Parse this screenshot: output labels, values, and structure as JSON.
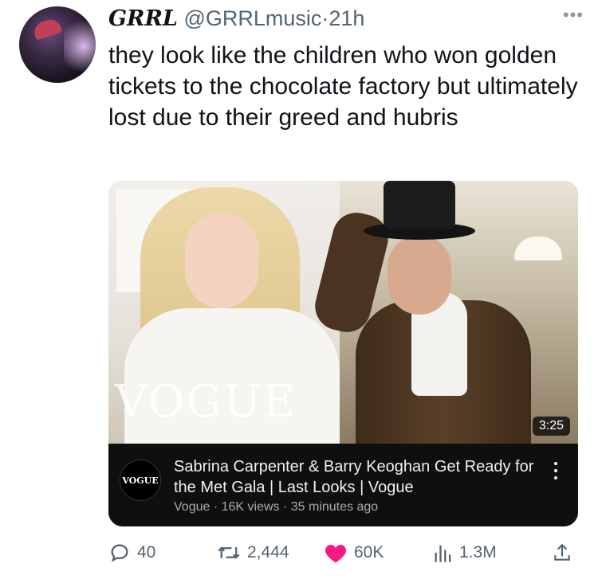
{
  "tweet": {
    "display_name": "GRRL",
    "handle": "@GRRLmusic",
    "separator": "·",
    "time": "21h",
    "more_icon": "more-horizontal-icon",
    "text": "they look like the children who won golden tickets to the chocolate factory but ultimately lost due to their greed and hubris"
  },
  "media": {
    "watermark": "VOGUE",
    "duration": "3:25",
    "channel_avatar_text": "VOGUE",
    "title": "Sabrina Carpenter & Barry Keoghan Get Ready for the Met Gala | Last Looks | Vogue",
    "meta": "Vogue · 16K views · 35 minutes ago"
  },
  "actions": {
    "replies": "40",
    "retweets": "2,444",
    "likes": "60K",
    "views": "1.3M"
  },
  "colors": {
    "text": "#0f1419",
    "secondary": "#536471",
    "like": "#f91880"
  }
}
